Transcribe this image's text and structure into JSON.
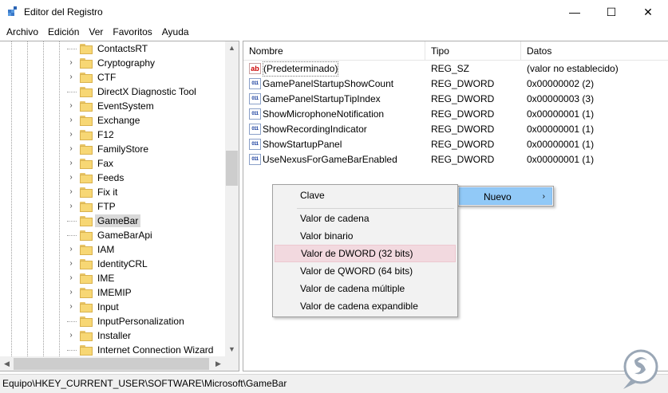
{
  "window": {
    "title": "Editor del Registro",
    "buttons": {
      "minimize": "—",
      "maximize": "☐",
      "close": "✕"
    }
  },
  "menubar": [
    "Archivo",
    "Edición",
    "Ver",
    "Favoritos",
    "Ayuda"
  ],
  "tree": {
    "items": [
      {
        "label": "ContactsRT",
        "expandable": false
      },
      {
        "label": "Cryptography",
        "expandable": true
      },
      {
        "label": "CTF",
        "expandable": true
      },
      {
        "label": "DirectX Diagnostic Tool",
        "expandable": false
      },
      {
        "label": "EventSystem",
        "expandable": true
      },
      {
        "label": "Exchange",
        "expandable": true
      },
      {
        "label": "F12",
        "expandable": true
      },
      {
        "label": "FamilyStore",
        "expandable": true
      },
      {
        "label": "Fax",
        "expandable": true
      },
      {
        "label": "Feeds",
        "expandable": true
      },
      {
        "label": "Fix it",
        "expandable": true
      },
      {
        "label": "FTP",
        "expandable": true
      },
      {
        "label": "GameBar",
        "expandable": false,
        "selected": true
      },
      {
        "label": "GameBarApi",
        "expandable": false
      },
      {
        "label": "IAM",
        "expandable": true
      },
      {
        "label": "IdentityCRL",
        "expandable": true
      },
      {
        "label": "IME",
        "expandable": true
      },
      {
        "label": "IMEMIP",
        "expandable": true
      },
      {
        "label": "Input",
        "expandable": true
      },
      {
        "label": "InputPersonalization",
        "expandable": false
      },
      {
        "label": "Installer",
        "expandable": true
      },
      {
        "label": "Internet Connection Wizard",
        "expandable": false
      }
    ]
  },
  "list": {
    "columns": {
      "name": "Nombre",
      "type": "Tipo",
      "data": "Datos"
    },
    "rows": [
      {
        "name": "(Predeterminado)",
        "type": "REG_SZ",
        "data": "(valor no establecido)",
        "icon": "string-value-icon"
      },
      {
        "name": "GamePanelStartupShowCount",
        "type": "REG_DWORD",
        "data": "0x00000002 (2)",
        "icon": "binary-value-icon"
      },
      {
        "name": "GamePanelStartupTipIndex",
        "type": "REG_DWORD",
        "data": "0x00000003 (3)",
        "icon": "binary-value-icon"
      },
      {
        "name": "ShowMicrophoneNotification",
        "type": "REG_DWORD",
        "data": "0x00000001 (1)",
        "icon": "binary-value-icon"
      },
      {
        "name": "ShowRecordingIndicator",
        "type": "REG_DWORD",
        "data": "0x00000001 (1)",
        "icon": "binary-value-icon"
      },
      {
        "name": "ShowStartupPanel",
        "type": "REG_DWORD",
        "data": "0x00000001 (1)",
        "icon": "binary-value-icon"
      },
      {
        "name": "UseNexusForGameBarEnabled",
        "type": "REG_DWORD",
        "data": "0x00000001 (1)",
        "icon": "binary-value-icon"
      }
    ]
  },
  "context_menu": {
    "new_label": "Nuevo",
    "submenu": {
      "key": "Clave",
      "items": [
        "Valor de cadena",
        "Valor binario",
        "Valor de DWORD (32 bits)",
        "Valor de QWORD (64 bits)",
        "Valor de cadena múltiple",
        "Valor de cadena expandible"
      ],
      "hovered_index": 2
    }
  },
  "statusbar": {
    "path": "Equipo\\HKEY_CURRENT_USER\\SOFTWARE\\Microsoft\\GameBar"
  }
}
